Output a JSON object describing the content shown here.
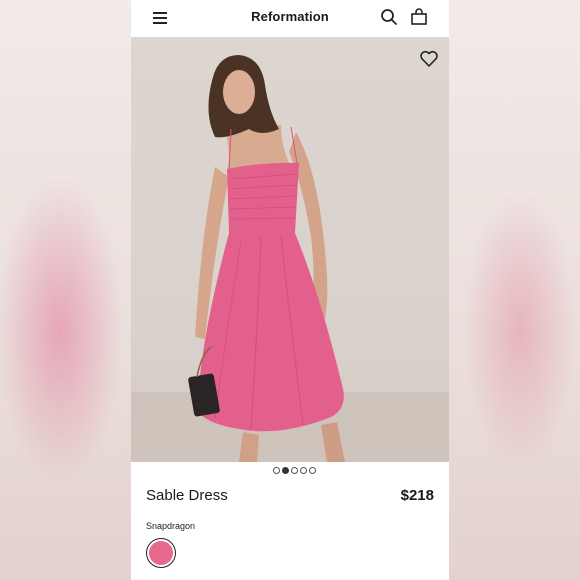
{
  "header": {
    "brand": "Reformation",
    "menu_icon": "hamburger-menu-icon",
    "search_icon": "search-icon",
    "bag_icon": "shopping-bag-icon"
  },
  "hero": {
    "favorite_icon": "heart-icon",
    "carousel_total": 5,
    "carousel_active": 2
  },
  "product": {
    "name": "Sable Dress",
    "price": "$218",
    "color_name": "Snapdragon",
    "color_hex": "#e8688e"
  },
  "colors": {
    "dress": "#e35f8c",
    "dress_shadow": "#c9467a",
    "skin": "#d8a98f",
    "hair": "#4a3224"
  }
}
